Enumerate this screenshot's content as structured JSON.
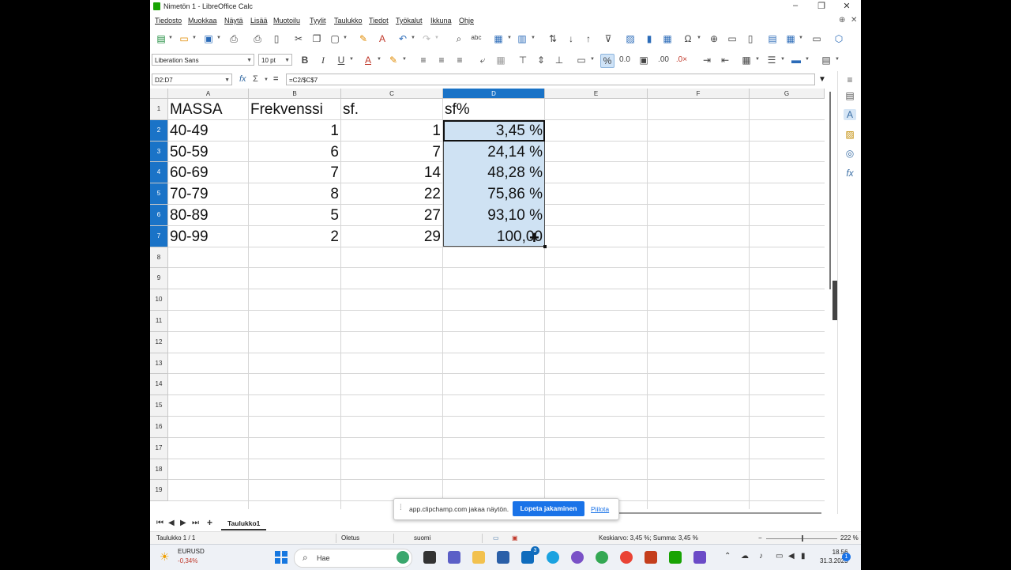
{
  "window": {
    "title": "Nimetön 1 - LibreOffice Calc",
    "minimize": "–",
    "maximize": "❐",
    "close": "✕"
  },
  "menu": [
    "Tiedosto",
    "Muokkaa",
    "Näytä",
    "Lisää",
    "Muotoilu",
    "Tyylit",
    "Taulukko",
    "Tiedot",
    "Työkalut",
    "Ikkuna",
    "Ohje"
  ],
  "format_bar": {
    "font_name": "Liberation Sans",
    "font_size": "10 pt"
  },
  "formula_bar": {
    "name_box": "D2:D7",
    "formula": "=C2/$C$7"
  },
  "columns": [
    "A",
    "B",
    "C",
    "D",
    "E",
    "F",
    "G"
  ],
  "rows": [
    "1",
    "2",
    "3",
    "4",
    "5",
    "6",
    "7",
    "8",
    "9",
    "10",
    "11",
    "12",
    "13",
    "14",
    "15",
    "16",
    "17",
    "18",
    "19"
  ],
  "table": [
    {
      "a": "MASSA",
      "b": "Frekvenssi",
      "c": "sf.",
      "d": "sf%"
    },
    {
      "a": "40-49",
      "b": "1",
      "c": "1",
      "d": "3,45 %"
    },
    {
      "a": "50-59",
      "b": "6",
      "c": "7",
      "d": "24,14 %"
    },
    {
      "a": "60-69",
      "b": "7",
      "c": "14",
      "d": "48,28 %"
    },
    {
      "a": "70-79",
      "b": "8",
      "c": "22",
      "d": "75,86 %"
    },
    {
      "a": "80-89",
      "b": "5",
      "c": "27",
      "d": "93,10 %"
    },
    {
      "a": "90-99",
      "b": "2",
      "c": "29",
      "d": "100,00"
    }
  ],
  "sheet_tab": "Taulukko1",
  "status": {
    "sheet": "Taulukko 1 / 1",
    "style": "Oletus",
    "language": "suomi",
    "summary": "Keskiarvo: 3,45 %; Summa: 3,45 %",
    "zoom": "222 %"
  },
  "share_banner": {
    "message": "app.clipchamp.com jakaa näytön.",
    "stop": "Lopeta jakaminen",
    "hide": "Piilota"
  },
  "taskbar": {
    "ticker": "EURUSD",
    "change": "-0,34%",
    "search": "Hae",
    "time": "18.56",
    "date": "31.3.2023",
    "badge": "3",
    "notification": "1"
  }
}
